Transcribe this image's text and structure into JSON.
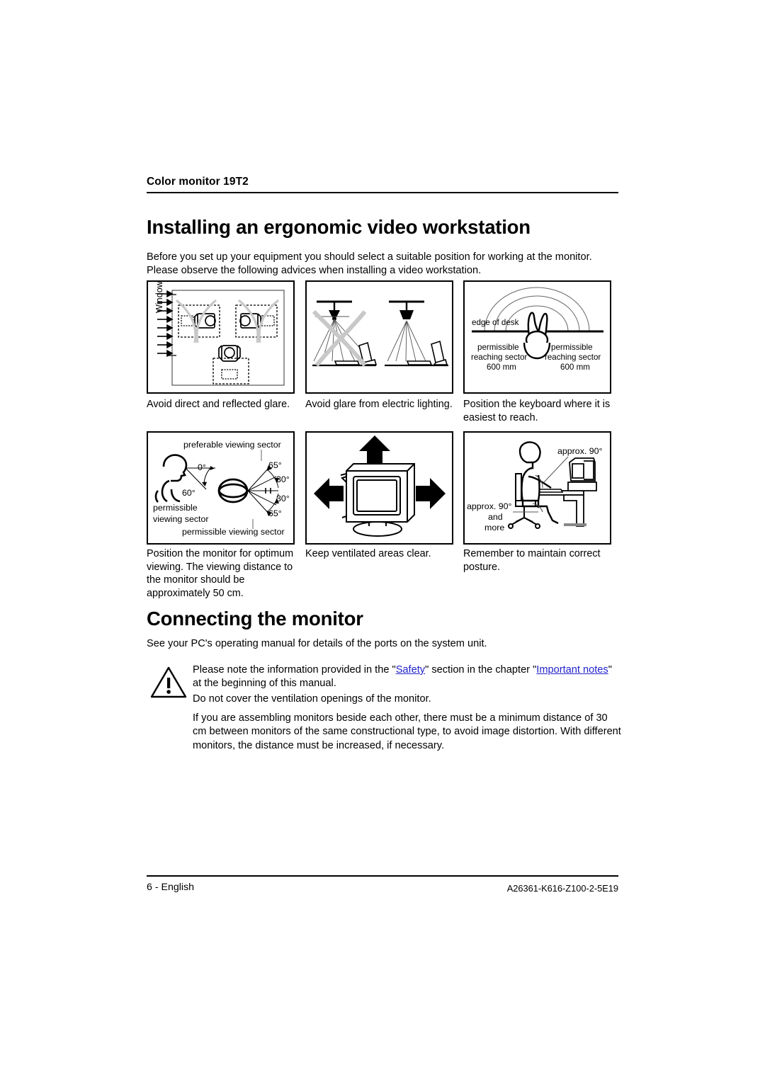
{
  "header": {
    "running_title": "Color monitor 19T2"
  },
  "sections": {
    "ergonomic": {
      "heading": "Installing an ergonomic video workstation",
      "intro": "Before you set up your equipment you should select a suitable position for working at the monitor. Please observe the following advices when installing a video workstation."
    },
    "connecting": {
      "heading": "Connecting the monitor",
      "intro": "See your PC's operating manual for details of the ports on the system unit.",
      "note_safety_part1": "Please note the information provided in the \"",
      "note_safety_link1": "Safety",
      "note_safety_part2": "\" section in the chapter \"",
      "note_safety_link2": "Important notes",
      "note_safety_part3": "\" at the beginning of this manual.",
      "note_ventilation": "Do not cover the ventilation openings of the monitor.",
      "note_distance": "If you are assembling monitors beside each other, there must be a minimum distance of 30 cm between monitors of the same constructional type, to avoid image distortion. With different monitors, the distance must be increased, if necessary."
    }
  },
  "figures": [
    {
      "id": "glare-window",
      "caption": "Avoid direct and reflected glare.",
      "labels": {
        "window": "Window"
      }
    },
    {
      "id": "glare-lighting",
      "caption": "Avoid glare from electric lighting.",
      "labels": {}
    },
    {
      "id": "keyboard-reach",
      "caption": "Position the keyboard where it is easiest to reach.",
      "labels": {
        "edge_of_desk": "edge of desk",
        "left_permissible": "permissible",
        "left_sector": "reaching sector",
        "left_distance": "600 mm",
        "right_permissible": "permissible",
        "right_sector": "reaching sector",
        "right_distance": "600 mm"
      }
    },
    {
      "id": "viewing-sector",
      "caption": "Position the monitor for optimum viewing. The viewing distance to the monitor should be approximately 50 cm.",
      "labels": {
        "preferable_viewing_sector": "preferable viewing sector",
        "permissible_1": "permissible",
        "permissible_2": "viewing sector",
        "permissible_bottom": "permissible viewing sector",
        "angle_0": "0°",
        "angle_60": "60°",
        "angle_65_top": "65°",
        "angle_30_top": "30°",
        "angle_30_bottom": "30°",
        "angle_65_bottom": "65°"
      }
    },
    {
      "id": "ventilation",
      "caption": "Keep ventilated areas clear.",
      "labels": {}
    },
    {
      "id": "posture",
      "caption": "Remember to maintain correct posture.",
      "labels": {
        "angle_top": "approx. 90°",
        "angle_bottom_1": "approx. 90°",
        "angle_bottom_2": "and",
        "angle_bottom_3": "more"
      }
    }
  ],
  "footer": {
    "page_label": "6 - English",
    "doc_number": "A26361-K616-Z100-2-5E19"
  },
  "colors": {
    "text": "#000000",
    "link": "#2222cc",
    "glare_x": "#c8c8c8"
  }
}
